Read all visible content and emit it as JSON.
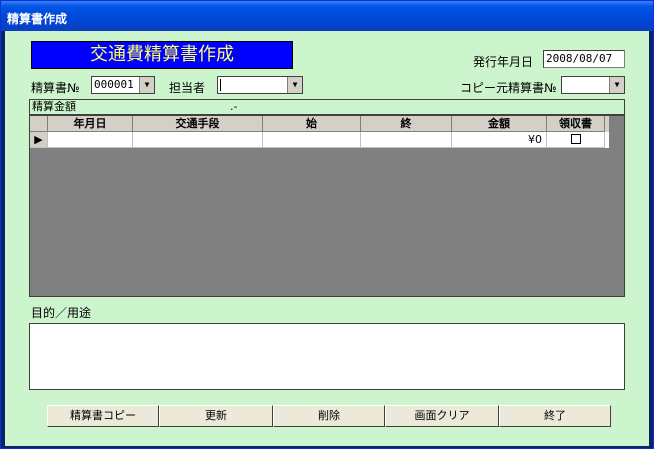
{
  "window": {
    "title": "精算書作成"
  },
  "banner": {
    "text": "交通費精算書作成"
  },
  "issue": {
    "label": "発行年月日",
    "value": "2008/08/07"
  },
  "form": {
    "no_label": "精算書№",
    "no_value": "000001",
    "person_label": "担当者",
    "person_value": "",
    "copy_label": "コピー元精算書№",
    "copy_value": ""
  },
  "amount": {
    "label": "精算金額",
    "value": ".-"
  },
  "grid": {
    "columns": [
      "年月日",
      "交通手段",
      "始",
      "終",
      "金額",
      "領収書"
    ],
    "rows": [
      {
        "selector": "▶",
        "date": "",
        "means": "",
        "from": "",
        "to": "",
        "amount": "¥0",
        "receipt": false
      }
    ]
  },
  "purpose": {
    "label": "目的／用途",
    "value": ""
  },
  "buttons": {
    "copy": "精算書コピー",
    "update": "更新",
    "delete": "削除",
    "clear": "画面クリア",
    "exit": "終了"
  },
  "icons": {
    "dropdown": "dropdown-arrow-icon",
    "row_selector": "row-pointer-icon",
    "checkbox": "checkbox-icon"
  }
}
